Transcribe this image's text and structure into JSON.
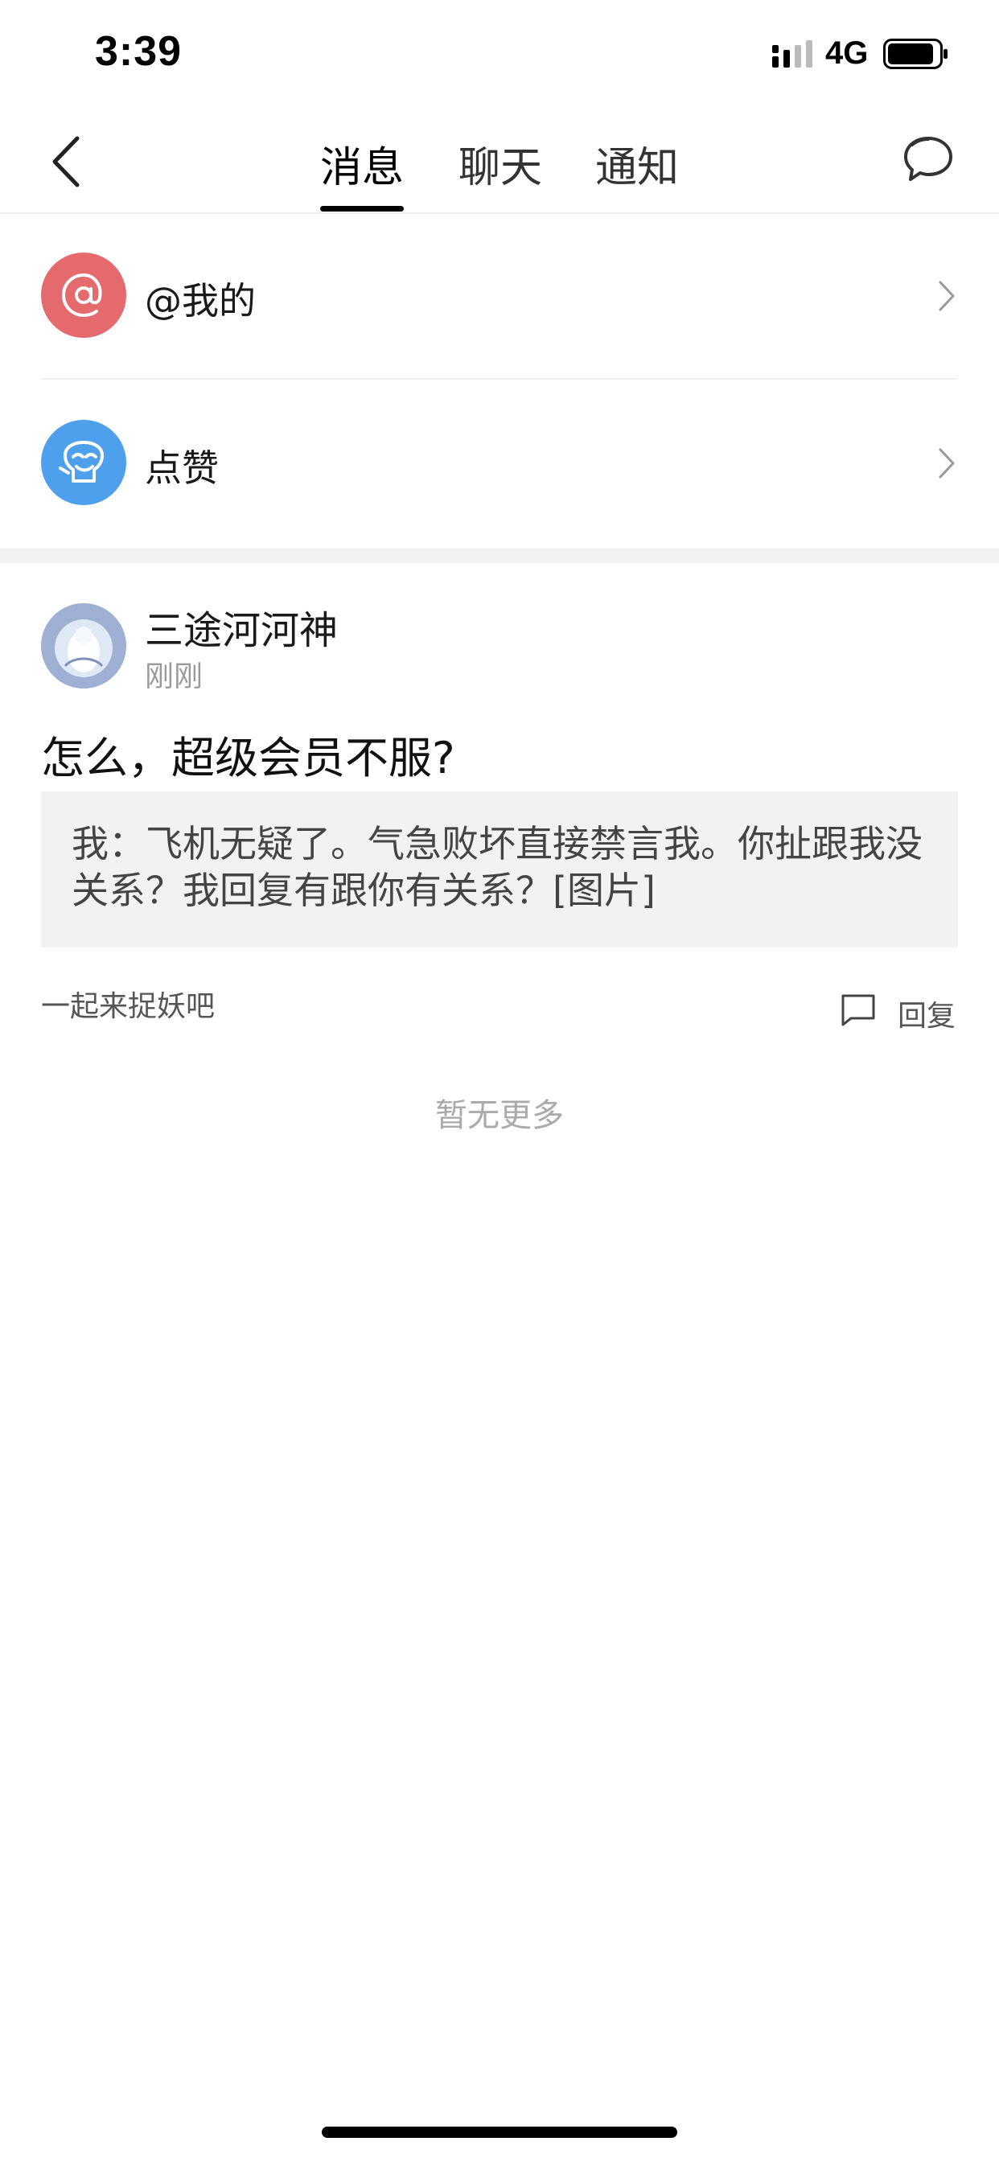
{
  "status_bar": {
    "time": "3:39",
    "network": "4G"
  },
  "nav": {
    "tabs": [
      {
        "label": "消息",
        "active": true
      },
      {
        "label": "聊天",
        "active": false
      },
      {
        "label": "通知",
        "active": false
      }
    ]
  },
  "rows": [
    {
      "label": "@我的",
      "icon": "at-icon",
      "color": "#e46a6e"
    },
    {
      "label": "点赞",
      "icon": "like-icon",
      "color": "#4fa0ec"
    }
  ],
  "post": {
    "author": "三途河河神",
    "time": "刚刚",
    "title": "怎么，超级会员不服?",
    "quote": "我：飞机无疑了。气急败坏直接禁言我。你扯跟我没关系？我回复有跟你有关系？[图片]",
    "source": "一起来捉妖吧",
    "reply_label": "回复"
  },
  "footer": {
    "no_more": "暂无更多"
  }
}
